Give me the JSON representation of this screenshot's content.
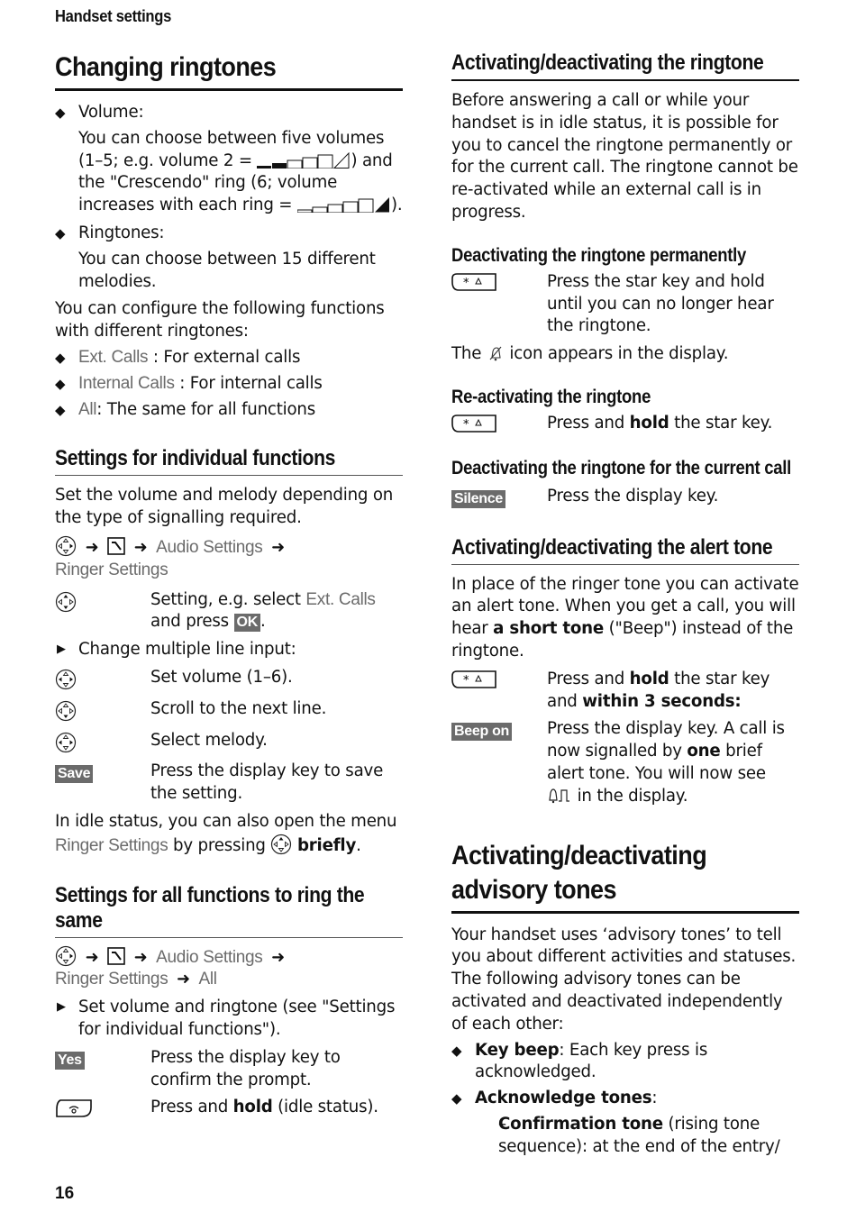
{
  "header": {
    "section": "Handset settings"
  },
  "footer": {
    "page_number": "16"
  },
  "left": {
    "title": "Changing ringtones",
    "volume_label": "Volume:",
    "volume_text_1": "You can choose between five volumes (1–5; e.g. volume 2 =",
    "volume_text_2": ") and the \"Crescendo\" ring (6; volume increases with each ring =",
    "volume_text_3": ").",
    "volume_example_level": 2,
    "volume_levels": 5,
    "ringtones_label": "Ringtones:",
    "ringtones_text": "You can choose between 15 different melodies.",
    "configure_text": "You can configure the following functions with different ringtones:",
    "functions": [
      {
        "menu": "Ext. Calls",
        "desc": " : For external calls"
      },
      {
        "menu": "Internal Calls",
        "desc": " : For internal calls"
      },
      {
        "menu": "All",
        "desc": ": The same for all functions"
      }
    ],
    "individual": {
      "title": "Settings for individual functions",
      "intro": "Set the volume and melody depending on the type of signalling required.",
      "path": {
        "audio_settings": "Audio Settings",
        "ringer_settings": "Ringer Settings"
      },
      "step1_a": "Setting, e.g. select ",
      "step1_menu": "Ext. Calls",
      "step1_b": " and press ",
      "step1_key": "OK",
      "step1_c": ".",
      "change_multi": "Change multiple line input:",
      "steps": [
        {
          "icon": "nav-key-left-right-icon",
          "text": "Set volume (1–6)."
        },
        {
          "icon": "nav-key-down-icon",
          "text": "Scroll to the next line."
        },
        {
          "icon": "nav-key-left-right-icon",
          "text": "Select melody."
        }
      ],
      "save_key": "Save",
      "save_text": "Press the display key to save the setting.",
      "idle_a": "In idle status, you can also open the menu ",
      "idle_menu": "Ringer Settings",
      "idle_b": " by pressing ",
      "idle_bold": "briefly",
      "idle_c": "."
    },
    "all_same": {
      "title": "Settings for all functions to ring the same",
      "path": {
        "audio_settings": "Audio Settings",
        "ringer_settings": "Ringer Settings",
        "all": "All"
      },
      "set_text": "Set volume and ringtone (see \"Settings for individual functions\").",
      "yes_key": "Yes",
      "yes_text": "Press the display key to confirm the prompt.",
      "end_a": "Press and ",
      "end_bold": "hold",
      "end_b": " (idle status)."
    }
  },
  "right": {
    "ringtone": {
      "title": "Activating/deactivating the ringtone",
      "intro": "Before answering a call or while your handset is in idle status, it is possible for you to cancel the ringtone permanently or for the current call. The ringtone cannot be re-activated while an external call is in progress.",
      "perm_title": "Deactivating the ringtone permanently",
      "perm_text": "Press the star key and hold until you can no longer hear the ringtone.",
      "icon_a": "The ",
      "icon_b": " icon appears in the display.",
      "react_title": "Re-activating the ringtone",
      "react_a": "Press and ",
      "react_bold": "hold",
      "react_b": " the star key.",
      "current_title": "Deactivating the ringtone for the current call",
      "silence_key": "Silence",
      "silence_text": "Press the display key."
    },
    "alert": {
      "title": "Activating/deactivating the alert tone",
      "intro_a": "In place of the ringer tone you can activate an alert tone. When you get a call, you will hear ",
      "intro_bold": "a short tone",
      "intro_b": " (\"Beep\") instead of the ringtone.",
      "star_a": "Press and ",
      "star_bold1": "hold",
      "star_b": " the star key and ",
      "star_bold2": "within 3 seconds:",
      "beep_key": "Beep on",
      "beep_a": "Press the display key. A call is now signalled by ",
      "beep_bold": "one",
      "beep_b": " brief alert tone. You will now see ",
      "beep_c": " in the display."
    },
    "advisory": {
      "title": "Activating/deactivating advisory tones",
      "intro": "Your handset uses ‘advisory tones’ to tell you about different activities and statuses. The following advisory tones can be activated and deactivated independently of each other:",
      "key_beep_bold": "Key beep",
      "key_beep_text": ": Each key press is acknowledged.",
      "ack_bold": "Acknowledge tones",
      "ack_text": ":",
      "confirm_bold": "Confirmation tone",
      "confirm_text": " (rising tone sequence): at the end of the entry/"
    }
  }
}
